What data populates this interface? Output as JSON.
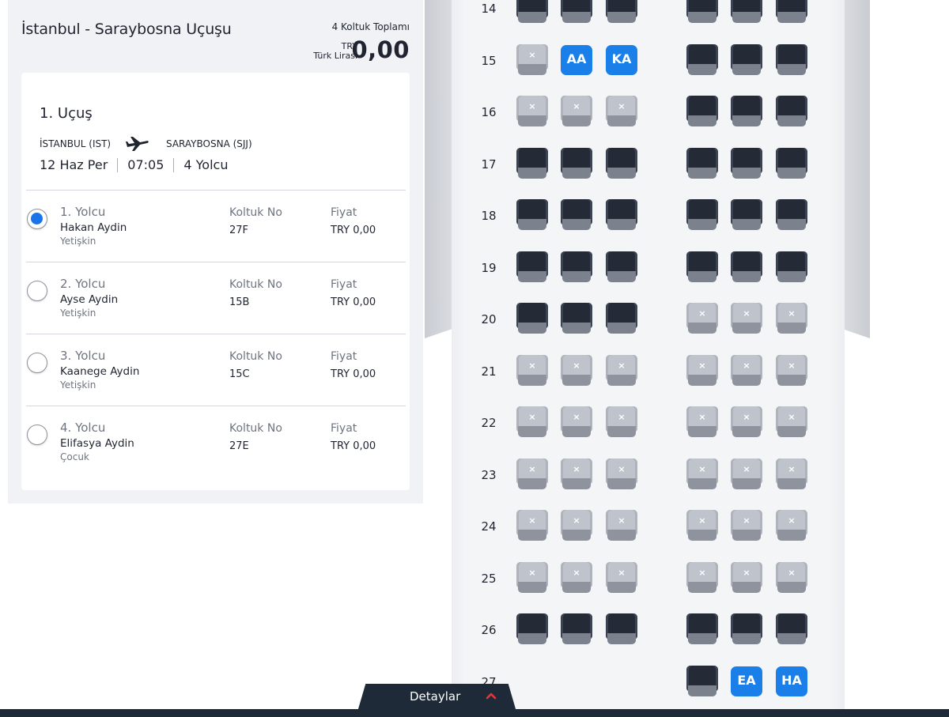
{
  "summary": {
    "title": "İstanbul - Saraybosna Uçuşu",
    "total_label": "4 Koltuk Toplamı",
    "currency_code": "TRY",
    "currency_name": "Türk Lirası",
    "total_amount": "0,00"
  },
  "flight": {
    "leg_title": "1. Uçuş",
    "from": "İSTANBUL (IST)",
    "to": "SARAYBOSNA (SJJ)",
    "date": "12 Haz Per",
    "time": "07:05",
    "passenger_count": "4 Yolcu",
    "plane_icon": "airplane-icon"
  },
  "labels": {
    "seat_no": "Koltuk No",
    "price": "Fiyat"
  },
  "passengers": [
    {
      "num": "1. Yolcu",
      "name": "Hakan Aydin",
      "type": "Yetişkin",
      "seat": "27F",
      "price": "TRY  0,00",
      "selected": true
    },
    {
      "num": "2. Yolcu",
      "name": "Ayse Aydin",
      "type": "Yetişkin",
      "seat": "15B",
      "price": "TRY  0,00",
      "selected": false
    },
    {
      "num": "3. Yolcu",
      "name": "Kaanege Aydin",
      "type": "Yetişkin",
      "seat": "15C",
      "price": "TRY  0,00",
      "selected": false
    },
    {
      "num": "4. Yolcu",
      "name": "Elifasya Aydin",
      "type": "Çocuk",
      "seat": "27E",
      "price": "TRY  0,00",
      "selected": false
    }
  ],
  "seatmap": {
    "unavailable_mark": "×",
    "rows": [
      {
        "num": "14",
        "seats": [
          "occupied",
          "occupied",
          "occupied",
          "occupied",
          "occupied",
          "occupied"
        ]
      },
      {
        "num": "15",
        "seats": [
          "unavail",
          "AA",
          "KA",
          "occupied",
          "occupied",
          "occupied"
        ]
      },
      {
        "num": "16",
        "seats": [
          "unavail",
          "unavail",
          "unavail",
          "occupied",
          "occupied",
          "occupied"
        ]
      },
      {
        "num": "17",
        "seats": [
          "occupied",
          "occupied",
          "occupied",
          "occupied",
          "occupied",
          "occupied"
        ]
      },
      {
        "num": "18",
        "seats": [
          "occupied",
          "occupied",
          "occupied",
          "occupied",
          "occupied",
          "occupied"
        ]
      },
      {
        "num": "19",
        "seats": [
          "occupied",
          "occupied",
          "occupied",
          "occupied",
          "occupied",
          "occupied"
        ]
      },
      {
        "num": "20",
        "seats": [
          "occupied",
          "occupied",
          "occupied",
          "unavail",
          "unavail",
          "unavail"
        ]
      },
      {
        "num": "21",
        "seats": [
          "unavail",
          "unavail",
          "unavail",
          "unavail",
          "unavail",
          "unavail"
        ]
      },
      {
        "num": "22",
        "seats": [
          "unavail",
          "unavail",
          "unavail",
          "unavail",
          "unavail",
          "unavail"
        ]
      },
      {
        "num": "23",
        "seats": [
          "unavail",
          "unavail",
          "unavail",
          "unavail",
          "unavail",
          "unavail"
        ]
      },
      {
        "num": "24",
        "seats": [
          "unavail",
          "unavail",
          "unavail",
          "unavail",
          "unavail",
          "unavail"
        ]
      },
      {
        "num": "25",
        "seats": [
          "unavail",
          "unavail",
          "unavail",
          "unavail",
          "unavail",
          "unavail"
        ]
      },
      {
        "num": "26",
        "seats": [
          "occupied",
          "occupied",
          "occupied",
          "occupied",
          "occupied",
          "occupied"
        ]
      },
      {
        "num": "27",
        "seats": [
          "none",
          "none",
          "none",
          "occupied",
          "EA",
          "HA"
        ]
      }
    ]
  },
  "footer": {
    "details_label": "Detaylar",
    "chevron_icon": "chevron-up-icon"
  },
  "colors": {
    "accent": "#1a7fe8",
    "occupied": "#242a36",
    "unavailable": "#bfc3cb",
    "footer": "#1f2a38"
  }
}
